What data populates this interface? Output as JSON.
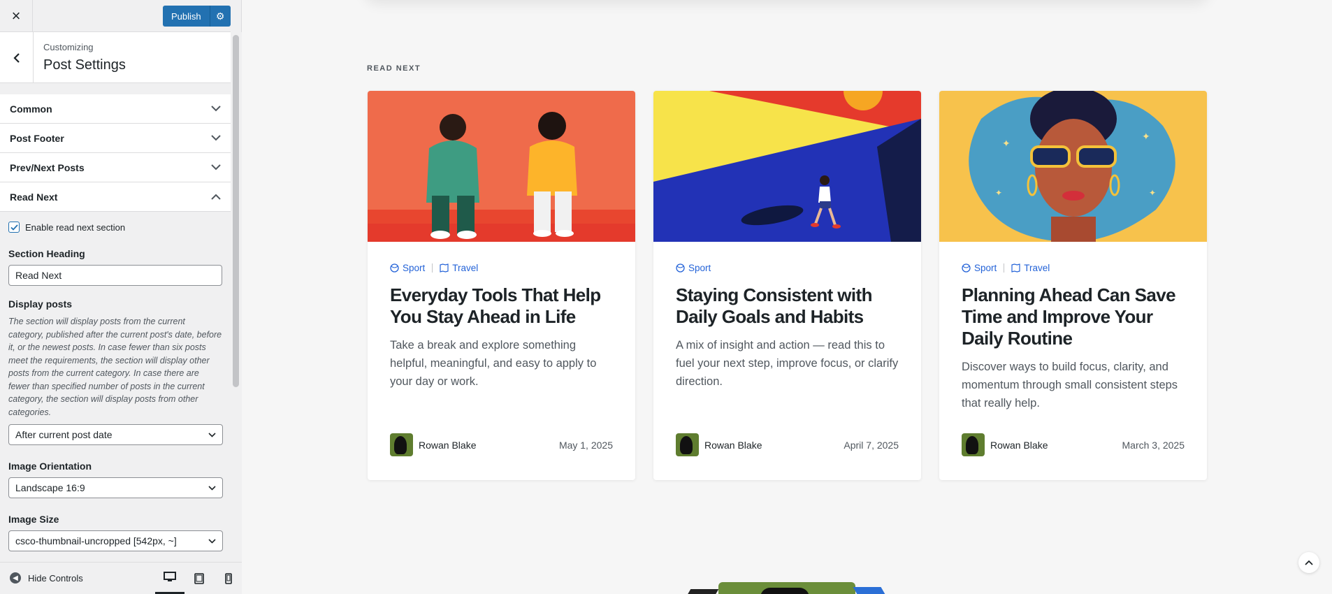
{
  "header": {
    "close_icon": "×",
    "publish_label": "Publish",
    "gear_icon": "⚙"
  },
  "panel": {
    "back_icon": "‹",
    "customizing_label": "Customizing",
    "title": "Post Settings"
  },
  "sections": [
    {
      "label": "Common",
      "open": false
    },
    {
      "label": "Post Footer",
      "open": false
    },
    {
      "label": "Prev/Next Posts",
      "open": false
    },
    {
      "label": "Read Next",
      "open": true
    }
  ],
  "read_next": {
    "enable_label": "Enable read next section",
    "enable_checked": true,
    "heading_label": "Section Heading",
    "heading_value": "Read Next",
    "display_label": "Display posts",
    "display_description": "The section will display posts from the current category, published after the current post's date, before it, or the newest posts. In case fewer than six posts meet the requirements, the section will display other posts from the current category. In case there are fewer than specified number of posts in the current category, the section will display posts from other categories.",
    "display_value": "After current post date",
    "orientation_label": "Image Orientation",
    "orientation_value": "Landscape 16:9",
    "size_label": "Image Size",
    "size_value": "csco-thumbnail-uncropped [542px, ~]"
  },
  "footer": {
    "hide_label": "Hide Controls",
    "devices": [
      "desktop",
      "tablet",
      "mobile"
    ],
    "active_device": "desktop"
  },
  "preview": {
    "heading": "READ NEXT",
    "cards": [
      {
        "categories": [
          "Sport",
          "Travel"
        ],
        "title": "Everyday Tools That Help You Stay Ahead in Life",
        "excerpt": "Take a break and explore something helpful, meaningful, and easy to apply to your day or work.",
        "author": "Rowan Blake",
        "date": "May 1, 2025"
      },
      {
        "categories": [
          "Sport"
        ],
        "title": "Staying Consistent with Daily Goals and Habits",
        "excerpt": "A mix of insight and action — read this to fuel your next step, improve focus, or clarify direction.",
        "author": "Rowan Blake",
        "date": "April 7, 2025"
      },
      {
        "categories": [
          "Sport",
          "Travel"
        ],
        "title": "Planning Ahead Can Save Time and Improve Your Daily Routine",
        "excerpt": "Discover ways to build focus, clarity, and momentum through small consistent steps that really help.",
        "author": "Rowan Blake",
        "date": "March 3, 2025"
      }
    ]
  },
  "colors": {
    "accent": "#2271b1",
    "link": "#2463d8"
  }
}
